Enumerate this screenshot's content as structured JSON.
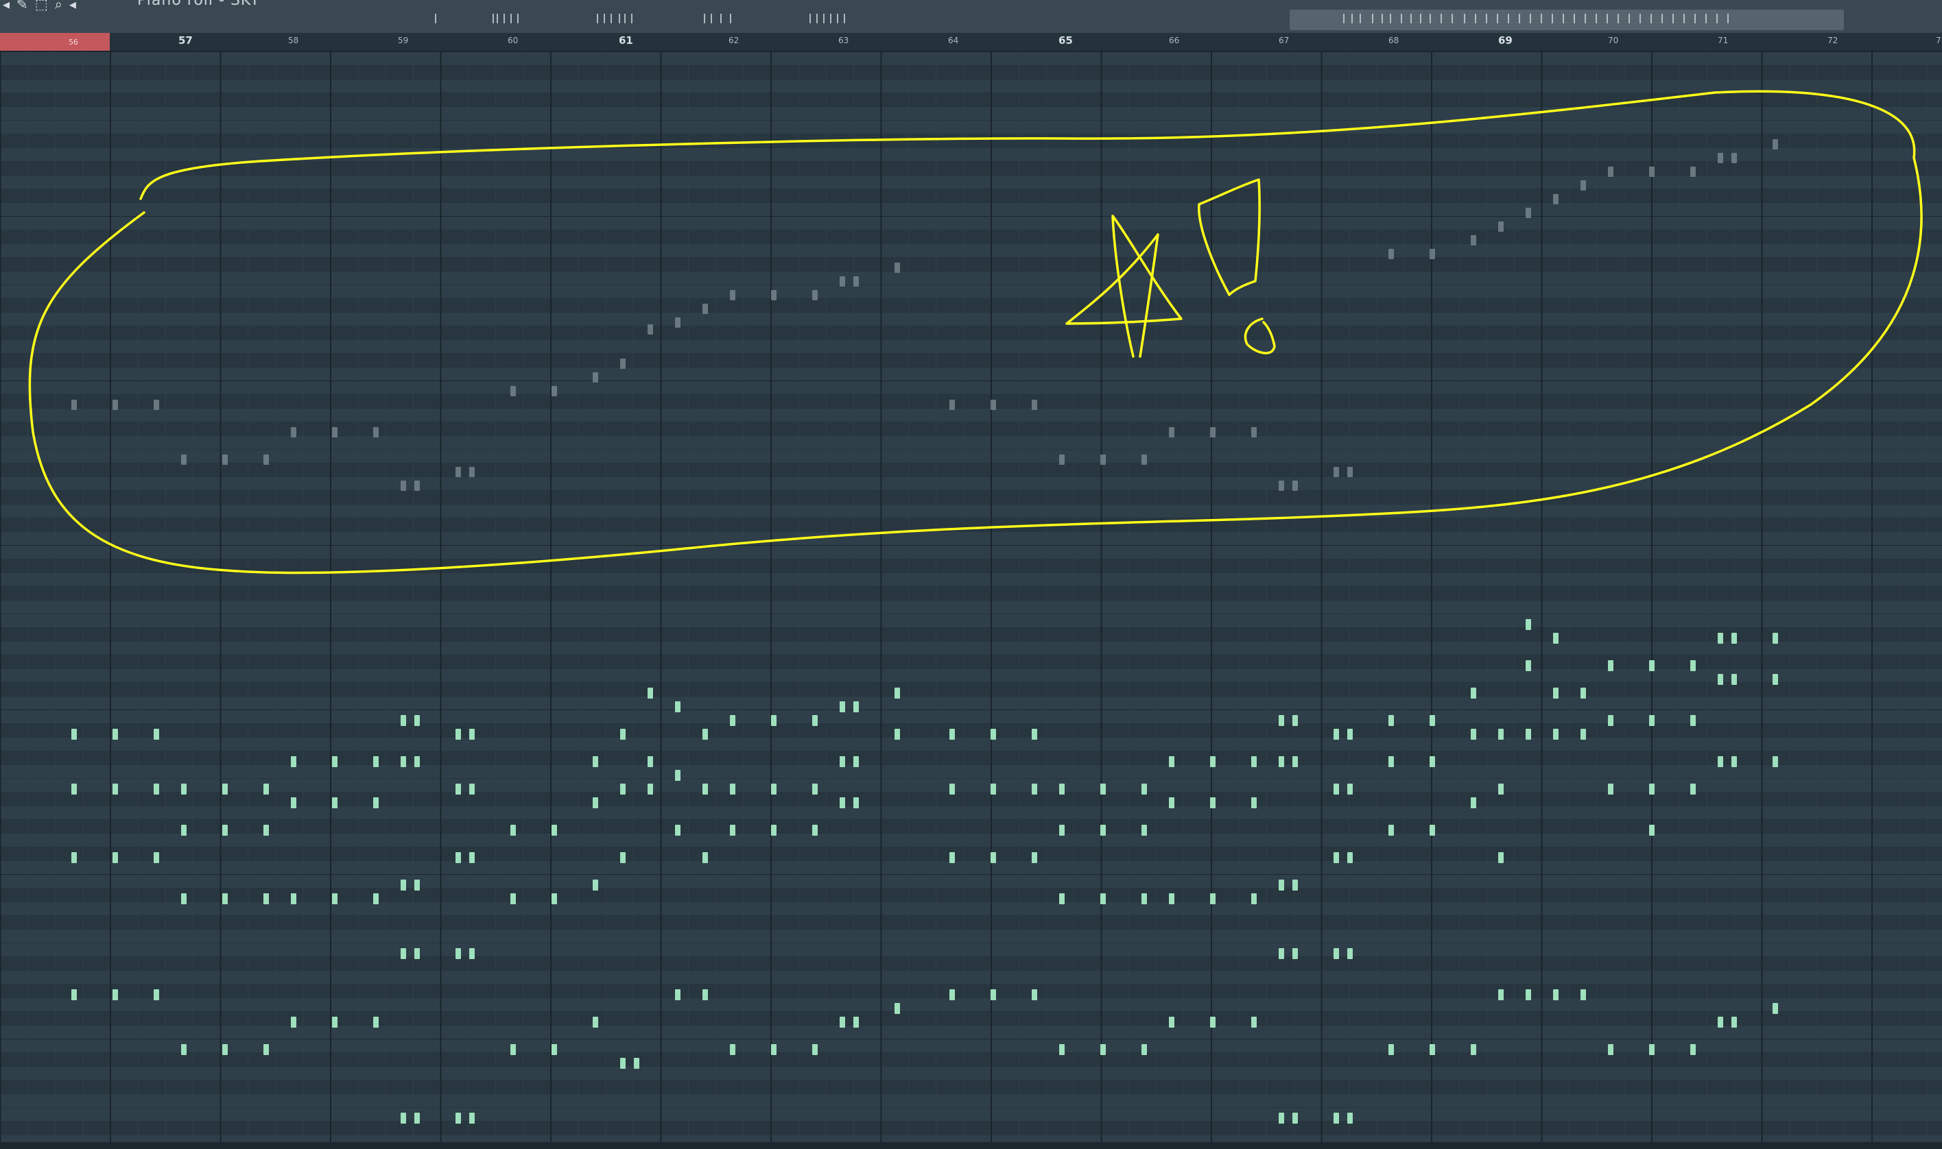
{
  "window": {
    "title": "Piano roll - SKT"
  },
  "toolbar": {
    "icons": [
      "arrow-icon",
      "pencil-icon",
      "select-icon",
      "zoom-icon",
      "speaker-icon",
      "speaker-icon-2"
    ]
  },
  "ruler": {
    "bars": [
      "56",
      "57",
      "58",
      "59",
      "60",
      "61",
      "62",
      "63",
      "64",
      "65",
      "66",
      "67",
      "68",
      "69",
      "70",
      "71",
      "72",
      "7"
    ],
    "loop_start_label": "56"
  },
  "colors": {
    "note": "#9fe0bd",
    "note_faded": "#7f8d96",
    "grid_bg": "#2b3b47",
    "annotation": "#ffff1a",
    "loop_marker": "#c4585c"
  },
  "annotation": {
    "description_shapes": [
      "ellipse-outline",
      "star",
      "exclamation"
    ]
  }
}
